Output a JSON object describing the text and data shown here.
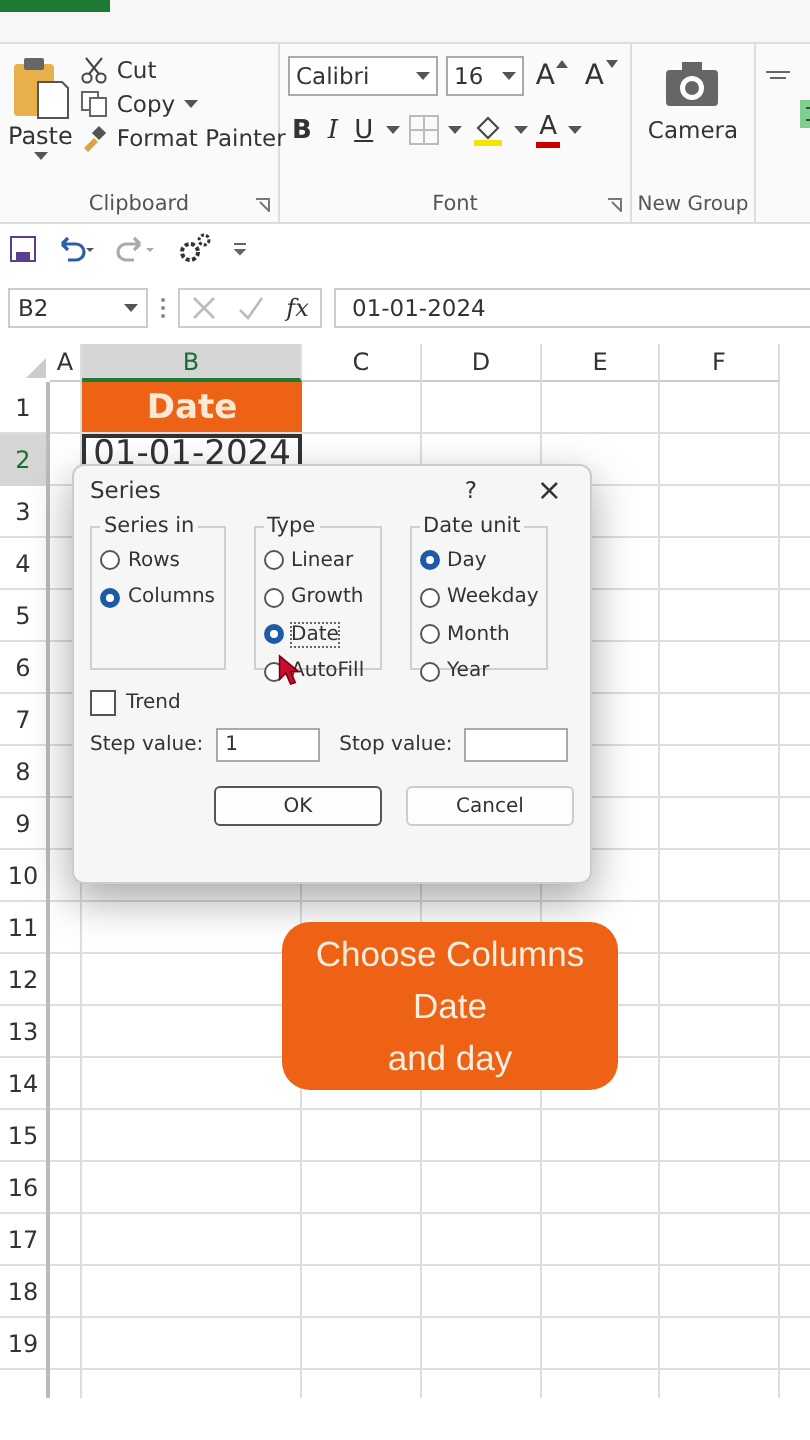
{
  "ribbon": {
    "clipboard": {
      "paste": "Paste",
      "cut": "Cut",
      "copy": "Copy",
      "format_painter": "Format Painter",
      "label": "Clipboard"
    },
    "font": {
      "name": "Calibri",
      "size": "16",
      "grow": "A",
      "shrink": "A",
      "bold": "B",
      "italic": "I",
      "underline": "U",
      "font_color": "A",
      "label": "Font"
    },
    "new_group": {
      "camera": "Camera",
      "label": "New Group"
    }
  },
  "formula_bar": {
    "name_box": "B2",
    "function_label": "fx",
    "value": "01-01-2024"
  },
  "sheet": {
    "columns": [
      {
        "label": "A",
        "selected": false
      },
      {
        "label": "B",
        "selected": true
      },
      {
        "label": "C",
        "selected": false
      },
      {
        "label": "D",
        "selected": false
      },
      {
        "label": "E",
        "selected": false
      },
      {
        "label": "F",
        "selected": false
      }
    ],
    "rows": [
      {
        "label": "1",
        "selected": false,
        "b": {
          "text": "Date",
          "kind": "header"
        }
      },
      {
        "label": "2",
        "selected": true,
        "b": {
          "text": "01-01-2024",
          "kind": "value"
        }
      },
      {
        "label": "3",
        "selected": false
      },
      {
        "label": "4",
        "selected": false
      },
      {
        "label": "5",
        "selected": false
      },
      {
        "label": "6",
        "selected": false
      },
      {
        "label": "7",
        "selected": false
      },
      {
        "label": "8",
        "selected": false
      },
      {
        "label": "9",
        "selected": false
      },
      {
        "label": "10",
        "selected": false
      },
      {
        "label": "11",
        "selected": false
      },
      {
        "label": "12",
        "selected": false
      },
      {
        "label": "13",
        "selected": false
      },
      {
        "label": "14",
        "selected": false
      },
      {
        "label": "15",
        "selected": false
      },
      {
        "label": "16",
        "selected": false
      },
      {
        "label": "17",
        "selected": false
      },
      {
        "label": "18",
        "selected": false
      },
      {
        "label": "19",
        "selected": false
      }
    ]
  },
  "dialog": {
    "title": "Series",
    "help": "?",
    "close": "×",
    "groups": [
      {
        "title": "Series in",
        "options": [
          {
            "label": "Rows",
            "selected": false
          },
          {
            "label": "Columns",
            "selected": true
          }
        ]
      },
      {
        "title": "Type",
        "options": [
          {
            "label": "Linear",
            "selected": false
          },
          {
            "label": "Growth",
            "selected": false
          },
          {
            "label": "Date",
            "selected": true
          },
          {
            "label": "AutoFill",
            "selected": false
          }
        ]
      },
      {
        "title": "Date unit",
        "options": [
          {
            "label": "Day",
            "selected": true
          },
          {
            "label": "Weekday",
            "selected": false
          },
          {
            "label": "Month",
            "selected": false
          },
          {
            "label": "Year",
            "selected": false
          }
        ]
      }
    ],
    "trend": {
      "label": "Trend",
      "checked": false
    },
    "step": {
      "label": "Step value:",
      "value": "1"
    },
    "stop": {
      "label": "Stop value:"
    },
    "buttons": [
      {
        "label": "OK",
        "default": true
      },
      {
        "label": "Cancel",
        "default": false
      }
    ]
  },
  "callout": {
    "text": "Choose Columns\nDate\nand day"
  }
}
